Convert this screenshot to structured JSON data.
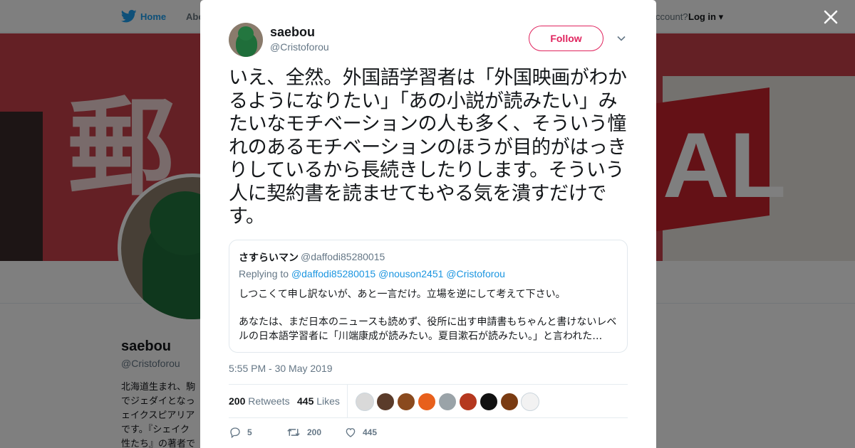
{
  "background": {
    "nav": {
      "home": "Home",
      "about": "Abo",
      "account": "ccount?",
      "login": "Log in"
    },
    "banner": {
      "kanji": "郵",
      "letters": "AL"
    },
    "profile": {
      "name": "saebou",
      "handle": "@Cristoforou",
      "bio_lines": [
        "北海道生まれ、駒",
        "でジェダイとなっ",
        "ェイクスピアリア",
        "です。『シェイク",
        "性たち』の著者で"
      ]
    }
  },
  "tweet": {
    "author": {
      "name": "saebou",
      "handle": "@Cristoforou"
    },
    "follow_label": "Follow",
    "text": "いえ、全然。外国語学習者は「外国映画がわかるようになりたい」「あの小説が読みたい」みたいなモチベーションの人も多く、そういう憧れのあるモチベーションのほうが目的がはっきりしているから長続きしたりします。そういう人に契約書を読ませてもやる気を潰すだけです。",
    "quote": {
      "name": "さすらいマン",
      "handle": "@daffodi85280015",
      "replying_prefix": "Replying to",
      "replying_to": "@daffodi85280015 @nouson2451 @Cristoforou",
      "body_para1": "しつこくて申し訳ないが、あと一言だけ。立場を逆にして考えて下さい。",
      "body_para2": "あなたは、まだ日本のニュースも読めず、役所に出す申請書もちゃんと書けないレベルの日本語学習者に「川端康成が読みたい。夏目漱石が読みたい。」と言われた…"
    },
    "timestamp": "5:55 PM - 30 May 2019",
    "stats": {
      "retweets_count": "200",
      "retweets_label": "Retweets",
      "likes_count": "445",
      "likes_label": "Likes"
    },
    "liker_colors": [
      "#d9d9d9",
      "#5a3b2a",
      "#8a4a1e",
      "#e8601c",
      "#9aa3a8",
      "#b5381f",
      "#111111",
      "#7a3b12",
      "#f2f2f2"
    ],
    "actions": {
      "replies": "5",
      "retweets": "200",
      "likes": "445"
    }
  }
}
